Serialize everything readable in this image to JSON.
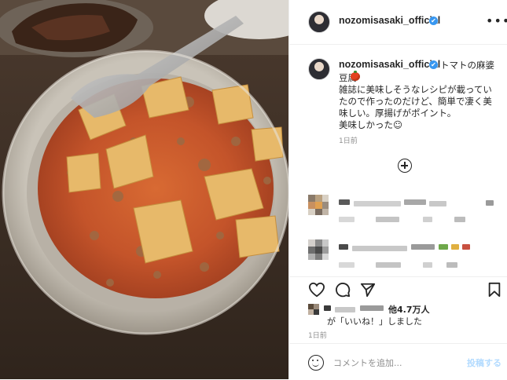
{
  "post": {
    "username": "nozomisasaki_official",
    "verified_mark": "✔",
    "more_icon": "•••",
    "caption": {
      "title_part": "トマトの麻婆",
      "continuation_part": "豆腐",
      "lines": [
        "雑誌に美味しそうなレシピが載ってい",
        "たので作ったのだけど、簡単で凄く美",
        "味しい。厚揚げがポイント。",
        "美味しかった☺"
      ],
      "time": "1日前"
    },
    "likes": {
      "count_text": "他4.7万人",
      "line2": "が「いいね！」しました"
    },
    "time": "1日前",
    "comment_placeholder": "コメントを追加...",
    "post_label": "投稿する"
  },
  "icons": [
    "heart-icon",
    "comment-icon",
    "share-icon",
    "bookmark-icon",
    "emoji-icon",
    "add-icon",
    "verified-icon",
    "more-icon",
    "tomato-emoji-icon"
  ],
  "colors": {
    "verified_blue": "#3897f0",
    "post_button_disabled": "#b3dbff",
    "meta_gray": "#8e8e8e",
    "divider": "#efefef",
    "sauce": "#c9552a",
    "tofu": "#e7b96a"
  }
}
